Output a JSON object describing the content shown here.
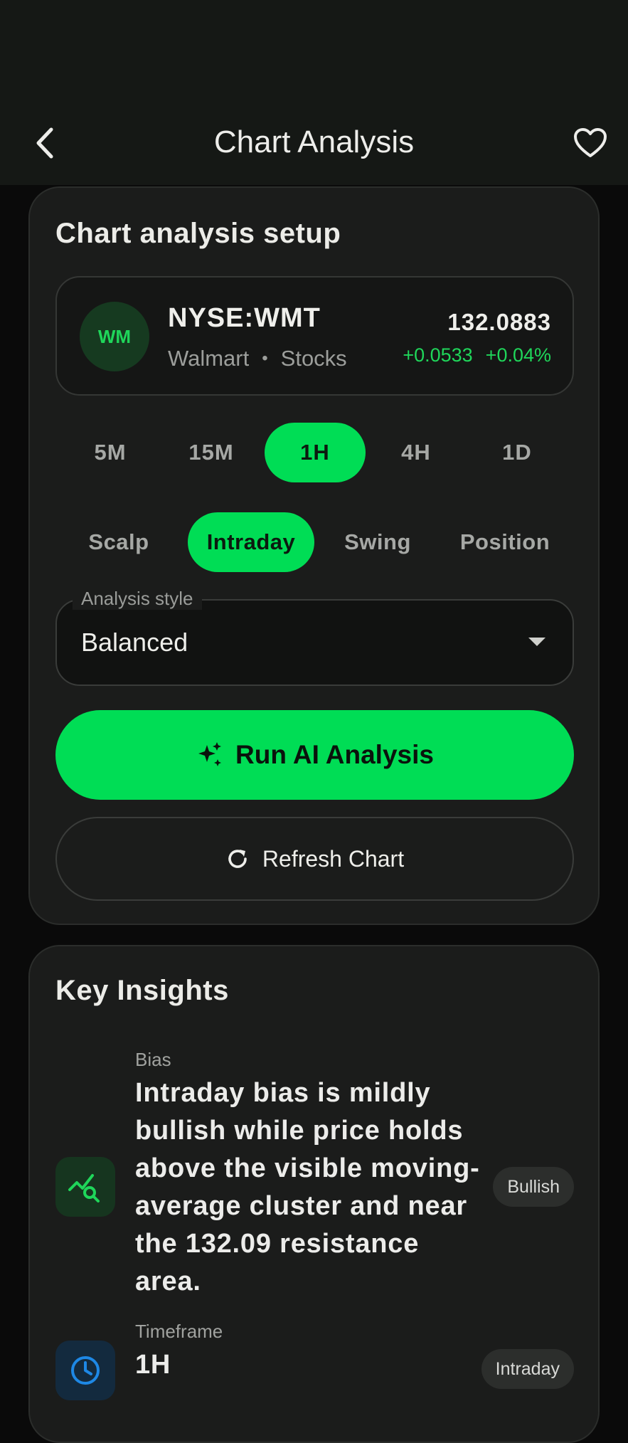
{
  "header": {
    "title": "Chart Analysis"
  },
  "setup": {
    "title": "Chart analysis setup",
    "symbol": {
      "avatar": "WM",
      "ticker": "NYSE:WMT",
      "name": "Walmart",
      "separator": "•",
      "type": "Stocks",
      "price": "132.0883",
      "change_abs": "+0.0533",
      "change_pct": "+0.04%"
    },
    "timeframes": [
      "5M",
      "15M",
      "1H",
      "4H",
      "1D"
    ],
    "selected_timeframe": "1H",
    "trade_styles": [
      "Scalp",
      "Intraday",
      "Swing",
      "Position"
    ],
    "selected_trade_style": "Intraday",
    "analysis_style": {
      "label": "Analysis style",
      "value": "Balanced"
    },
    "run_button": "Run AI Analysis",
    "refresh_button": "Refresh Chart"
  },
  "insights": {
    "title": "Key Insights",
    "items": [
      {
        "label": "Bias",
        "text": "Intraday bias is mildly bullish while price holds above the visible moving-average cluster and near the 132.09 resistance area.",
        "badge": "Bullish",
        "icon": "chart-search-icon"
      },
      {
        "label": "Timeframe",
        "text": "1H",
        "badge": "Intraday",
        "icon": "clock-icon"
      }
    ]
  },
  "colors": {
    "accent": "#00dd55",
    "positive": "#1fd65a",
    "card": "#1b1c1b",
    "background": "#0a0a0a",
    "clock_blue": "#1e88e5"
  }
}
